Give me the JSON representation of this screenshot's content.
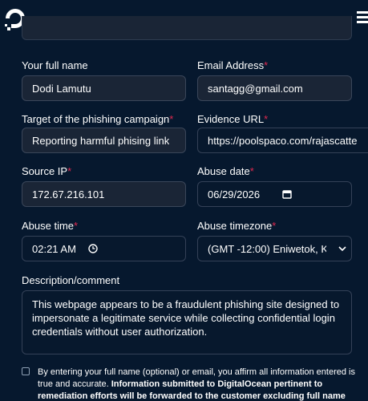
{
  "brand": {
    "logo_icon": "digitalocean-logo-icon"
  },
  "top_field": {
    "partial_value": ""
  },
  "fields": {
    "full_name": {
      "label": "Your full name",
      "value": "Dodi Lamutu"
    },
    "email": {
      "label": "Email Address",
      "value": "santagg@gmail.com",
      "required": "*"
    },
    "target": {
      "label": "Target of the phishing campaign",
      "value": "Reporting harmful phising link",
      "required": "*"
    },
    "evidence_url": {
      "label": "Evidence URL",
      "value": "https://poolspaco.com/rajascatte",
      "required": "*"
    },
    "source_ip": {
      "label": "Source IP",
      "value": "172.67.216.101",
      "required": "*"
    },
    "abuse_date": {
      "label": "Abuse date",
      "value": "06/29/2026",
      "required": "*"
    },
    "abuse_time": {
      "label": "Abuse time",
      "value": "02:21 AM",
      "required": "*"
    },
    "abuse_timezone": {
      "label": "Abuse timezone",
      "value": "(GMT -12:00) Eniwetok, K",
      "required": "*"
    },
    "description": {
      "label": "Description/comment",
      "value": "This webpage appears to be a fraudulent phishing site designed to impersonate a legitimate service while collecting confidential login credentials without user authorization."
    }
  },
  "consent": {
    "text": "By entering your full name (optional) or email, you affirm all information entered is true and accurate. ",
    "bold": "Information submitted to DigitalOcean pertinent to remediation efforts will be forwarded to the customer excluding full name and email.",
    "required": "*"
  },
  "colors": {
    "background": "#06182e",
    "required": "#e0294f",
    "field_bg": "#1a2536"
  }
}
